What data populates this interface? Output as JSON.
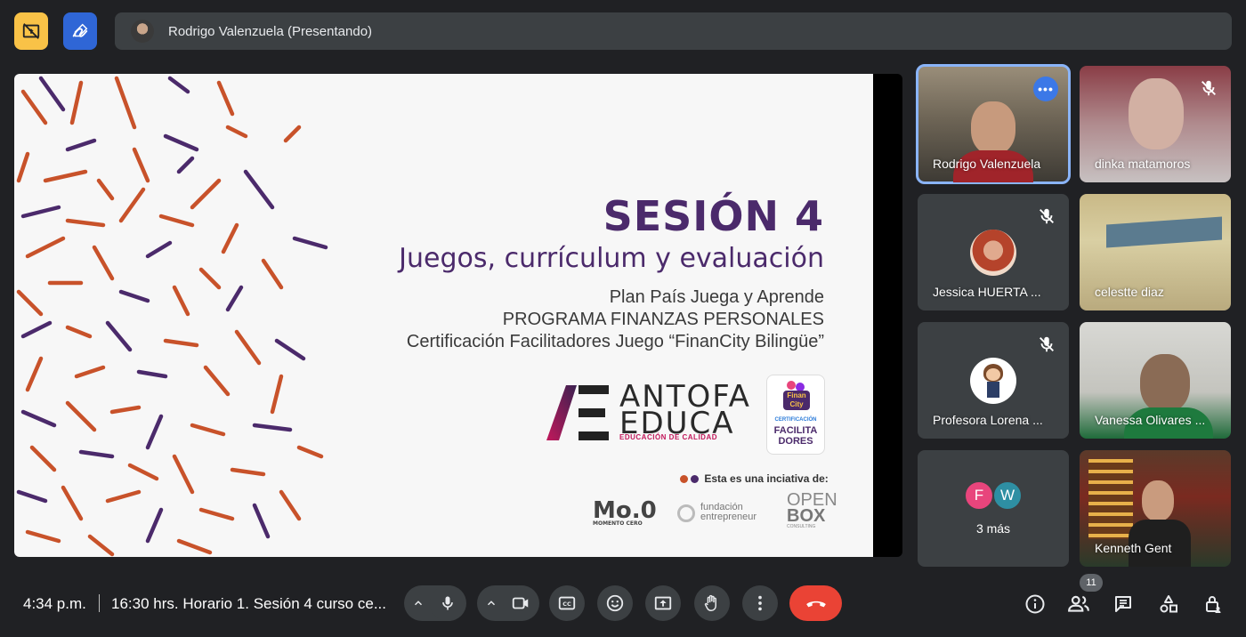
{
  "topbar": {
    "presenter_label": "Rodrigo Valenzuela (Presentando)",
    "icons": [
      "present-to-all-off-icon",
      "whiteboard-pen-icon"
    ]
  },
  "slide": {
    "title": "SESIÓN 4",
    "subtitle": "Juegos, currículum y evaluación",
    "line1": "Plan País Juega y Aprende",
    "line2": "PROGRAMA FINANZAS PERSONALES",
    "line3": "Certificación Facilitadores Juego “FinanCity Bilingüe”",
    "logo_word_1": "ANTOFA",
    "logo_word_2": "EDUCA",
    "logo_tag": "EDUCACIÓN DE CALIDAD",
    "badge_top": "Finan City",
    "badge_cert": "CERTIFICACIÓN",
    "badge_name_1": "FACILITA",
    "badge_name_2": "DORES",
    "initiative": "Esta es una inciativa de:",
    "partner_1": "Mo.0",
    "partner_1_sub": "MOMENTO CERO",
    "partner_2_a": "fundación",
    "partner_2_b": "entrepreneur",
    "partner_3_a": "OPEN",
    "partner_3_b": "BOX",
    "partner_3_sub": "CONSULTING"
  },
  "participants": [
    {
      "name": "Rodrigo Valenzuela",
      "muted": false,
      "active": true
    },
    {
      "name": "dinka matamoros",
      "muted": true
    },
    {
      "name": "Jessica HUERTA ...",
      "muted": true
    },
    {
      "name": "celestte diaz",
      "muted": false
    },
    {
      "name": "Profesora Lorena ...",
      "muted": true
    },
    {
      "name": "Vanessa Olivares ...",
      "muted": false
    },
    {
      "name": "Kenneth Gent",
      "muted": false
    }
  ],
  "more_tile": {
    "initials": [
      "F",
      "W"
    ],
    "colors": [
      "#e8457c",
      "#2e8fa3"
    ],
    "label": "3 más"
  },
  "bottombar": {
    "time": "4:34 p.m.",
    "meeting_title": "16:30 hrs. Horario 1. Sesión 4 curso ce...",
    "people_count": "11",
    "end_call_color": "#ea4335"
  }
}
